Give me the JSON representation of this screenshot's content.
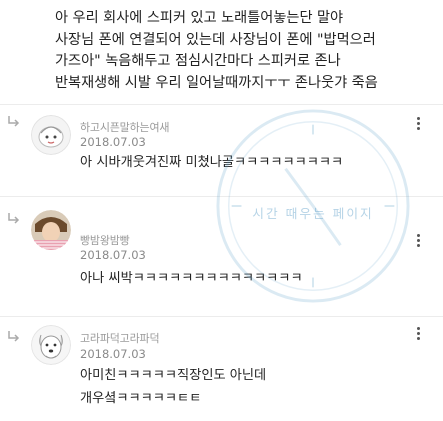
{
  "post": {
    "lines": [
      "아 우리 회사에 스피커 있고 노래틀어놓는단 말야",
      "사장님 폰에 연결되어 있는데 사장님이 폰에 \"밥먹으러",
      "가즈아\" 녹음해두고 점심시간마다 스피커로 존나",
      "반복재생해 시발 우리 일어날때까지ㅜㅜ 존나웃갸 죽음"
    ]
  },
  "watermark": {
    "text": "시간 때우는 페이지"
  },
  "comments": [
    {
      "nickname": "하고시픈말하는여새",
      "date": "2018.07.03",
      "lines": [
        "아 시바개웃겨진짜 미쳤나골ㅋㅋㅋㅋㅋㅋㅋㅋㅋ"
      ],
      "avatar_icon": "cartoon-face-avatar"
    },
    {
      "nickname": "빵밤왕밤빵",
      "date": "2018.07.03",
      "lines": [
        "아나 씨박ㅋㅋㅋㅋㅋㅋㅋㅋㅋㅋㅋㅋㅋㅋ"
      ],
      "avatar_icon": "photo-avatar"
    },
    {
      "nickname": "고라파덕고라파덕",
      "date": "2018.07.03",
      "lines": [
        "아미친ㅋㅋㅋㅋㅋ직장인도 아닌데",
        "개우셬ㅋㅋㅋㅋㅋㅌㅌ"
      ],
      "avatar_icon": "dog-avatar"
    }
  ],
  "colors": {
    "text": "#222222",
    "meta": "#8a8a8a",
    "divider": "#ececec",
    "watermark": "#5a9ec8"
  }
}
